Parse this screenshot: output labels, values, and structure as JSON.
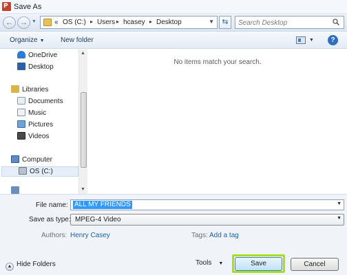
{
  "window": {
    "title": "Save As",
    "app_icon_letter": "P"
  },
  "nav": {
    "back_glyph": "←",
    "forward_glyph": "→",
    "overflow": "«",
    "path": [
      "OS (C:)",
      "Users",
      "hcasey",
      "Desktop"
    ],
    "search_placeholder": "Search Desktop"
  },
  "toolbar": {
    "organize": "Organize",
    "new_folder": "New folder",
    "help": "?"
  },
  "sidebar": {
    "items": [
      {
        "label": "OneDrive"
      },
      {
        "label": "Desktop"
      },
      {
        "label": "Libraries"
      },
      {
        "label": "Documents"
      },
      {
        "label": "Music"
      },
      {
        "label": "Pictures"
      },
      {
        "label": "Videos"
      },
      {
        "label": "Computer"
      },
      {
        "label": "OS (C:)"
      }
    ]
  },
  "content": {
    "empty_message": "No items match your search."
  },
  "form": {
    "file_name_label": "File name:",
    "file_name_value": "ALL MY FRIENDS",
    "save_as_type_label": "Save as type:",
    "save_as_type_value": "MPEG-4 Video",
    "authors_label": "Authors:",
    "authors_value": "Henry Casey",
    "tags_label": "Tags:",
    "tags_value": "Add a tag"
  },
  "footer": {
    "hide_folders": "Hide Folders",
    "tools": "Tools",
    "save": "Save",
    "cancel": "Cancel"
  },
  "colors": {
    "save_highlight": "#a5e01f",
    "selection": "#3399ff",
    "link": "#1c5fb0"
  }
}
